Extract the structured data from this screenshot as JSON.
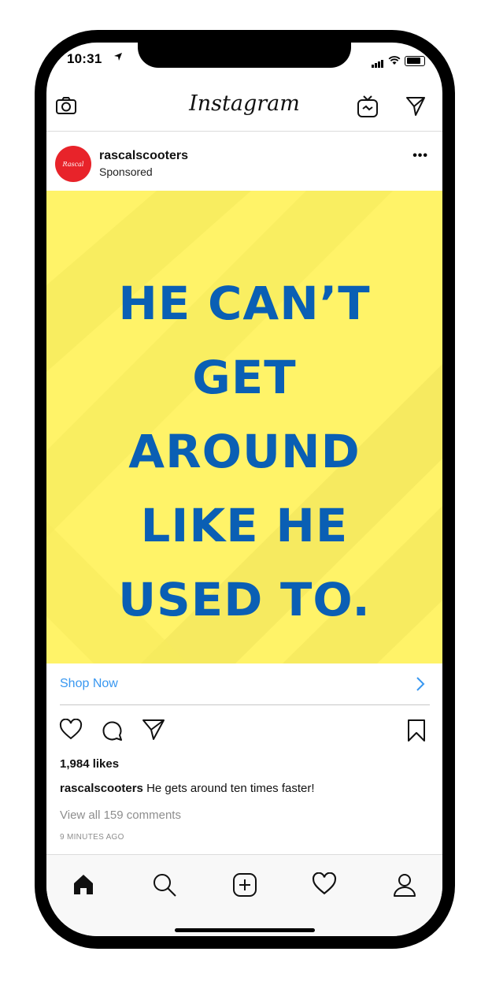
{
  "status": {
    "time": "10:31"
  },
  "app": {
    "title": "Instagram"
  },
  "post": {
    "username": "rascalscooters",
    "sponsored_label": "Sponsored",
    "avatar_text": "Rascal",
    "ad_lines": [
      "HE CAN’T",
      "GET",
      "AROUND",
      "LIKE HE",
      "USED TO."
    ],
    "cta_label": "Shop Now",
    "likes": "1,984 likes",
    "caption_user": "rascalscooters",
    "caption_text": " He gets around ten times faster!",
    "view_comments": "View all 159 comments",
    "timestamp": "9 MINUTES AGO"
  },
  "colors": {
    "ad_background": "#fff368",
    "ad_text": "#0a5fb4",
    "link": "#3897f0",
    "avatar": "#e8232a"
  },
  "icons": [
    "camera-icon",
    "igtv-icon",
    "direct-send-icon",
    "more-icon",
    "chevron-right-icon",
    "heart-icon",
    "comment-icon",
    "share-icon",
    "bookmark-icon",
    "home-icon",
    "search-icon",
    "add-post-icon",
    "activity-heart-icon",
    "profile-icon"
  ]
}
